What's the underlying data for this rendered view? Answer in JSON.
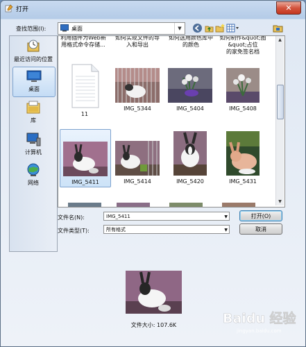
{
  "window": {
    "title": "打开",
    "close_glyph": "✕"
  },
  "toolbar": {
    "lookin_label": "查找范围(I):",
    "lookin_value": "桌面",
    "lookin_icon": "desktop-folder-icon"
  },
  "places": [
    {
      "label": "最近访问的位置",
      "icon": "recent-places-icon"
    },
    {
      "label": "桌面",
      "icon": "desktop-icon",
      "selected": true
    },
    {
      "label": "库",
      "icon": "libraries-icon"
    },
    {
      "label": "计算机",
      "icon": "computer-icon"
    },
    {
      "label": "网络",
      "icon": "network-icon"
    }
  ],
  "files": {
    "top_partial": [
      {
        "line1": "利用插件为Web新",
        "line2": "用格式命令存储..."
      },
      {
        "line1": "如何实现文件的导",
        "line2": "入和导出"
      },
      {
        "line1": "如何选用颜色库中",
        "line2": "的颜色"
      },
      {
        "line1": "如何制作&quot;图&quot;占位",
        "line2": "的家免签名档"
      }
    ],
    "row1": [
      "11",
      "IMG_5344",
      "IMG_5404",
      "IMG_5408"
    ],
    "row2": [
      "IMG_5411",
      "IMG_5414",
      "IMG_5420",
      "IMG_5431"
    ],
    "selected": "IMG_5411"
  },
  "form": {
    "filename_label": "文件名(N):",
    "filename_value": "IMG_5411",
    "filetype_label": "文件类型(T):",
    "filetype_value": "所有格式",
    "open_label": "打开(O)",
    "cancel_label": "取消"
  },
  "preview": {
    "filesize_text": "文件大小: 107.6K"
  },
  "watermark": {
    "text": "Baidu 经验",
    "sub": "jingyan.baidu.com"
  },
  "colors": {
    "accent": "#3c7fb1",
    "selection": "#cde3f8",
    "close": "#c3361f"
  }
}
